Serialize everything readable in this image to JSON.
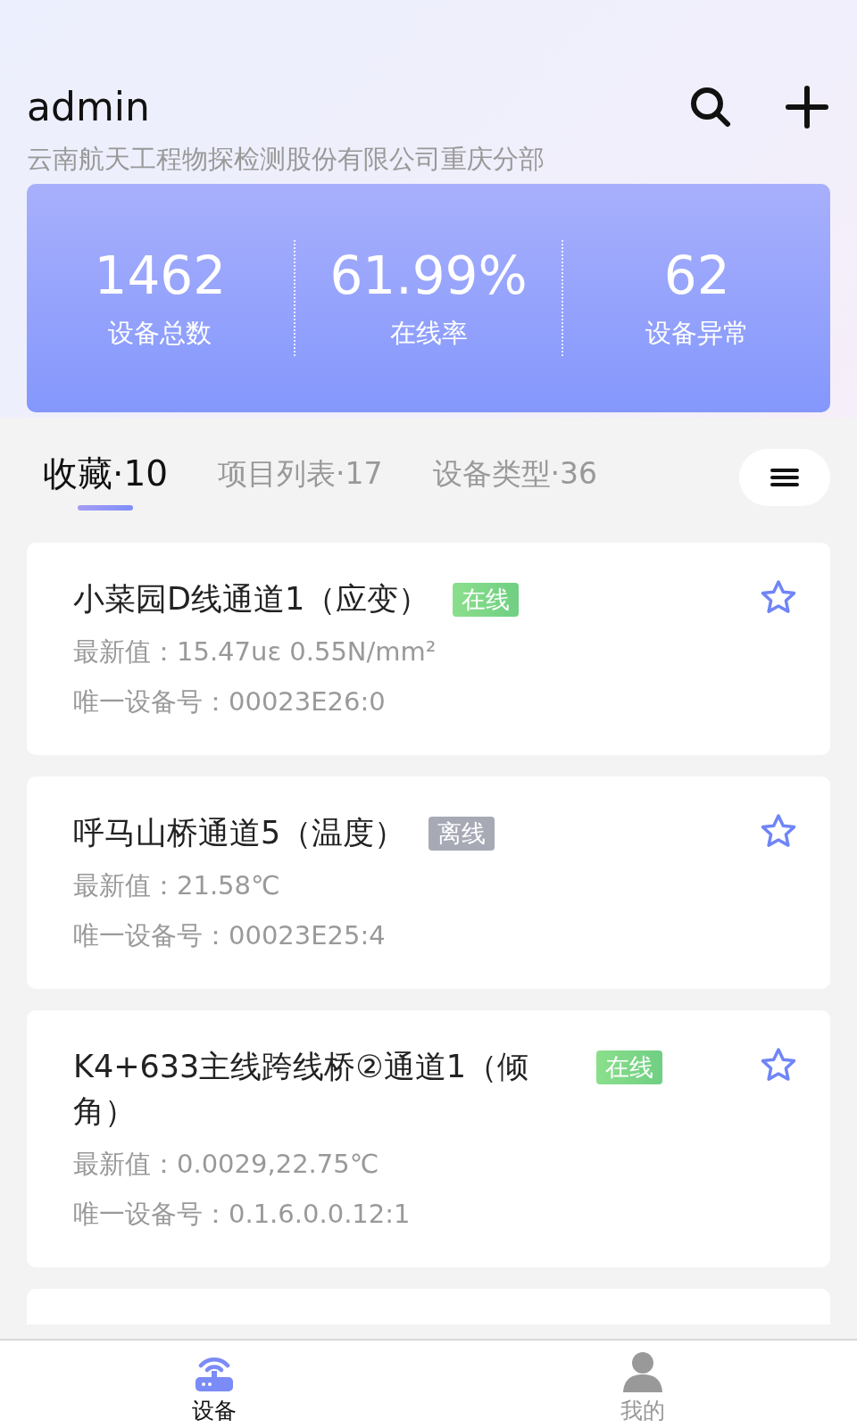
{
  "header": {
    "user": "admin",
    "company": "云南航天工程物探检测股份有限公司重庆分部"
  },
  "stats": [
    {
      "value": "1462",
      "label": "设备总数"
    },
    {
      "value": "61.99%",
      "label": "在线率"
    },
    {
      "value": "62",
      "label": "设备异常"
    }
  ],
  "tabs": [
    {
      "label": "收藏·10",
      "selected": true
    },
    {
      "label": "项目列表·17",
      "selected": false
    },
    {
      "label": "设备类型·36",
      "selected": false
    }
  ],
  "devices": [
    {
      "name": "小菜园D线通道1（应变）",
      "status": "在线",
      "online": true,
      "latest": "最新值：15.47uε 0.55N/mm²",
      "device_id": "唯一设备号：00023E26:0"
    },
    {
      "name": "呼马山桥通道5（温度）",
      "status": "离线",
      "online": false,
      "latest": "最新值：21.58℃",
      "device_id": "唯一设备号：00023E25:4"
    },
    {
      "name": "K4+633主线跨线桥②通道1（倾角）",
      "status": "在线",
      "online": true,
      "latest": "最新值：0.0029,22.75℃",
      "device_id": "唯一设备号：0.1.6.0.0.12:1"
    }
  ],
  "bottom_nav": [
    {
      "label": "设备",
      "kind": "device",
      "selected": true
    },
    {
      "label": "我的",
      "kind": "profile",
      "selected": false
    }
  ]
}
